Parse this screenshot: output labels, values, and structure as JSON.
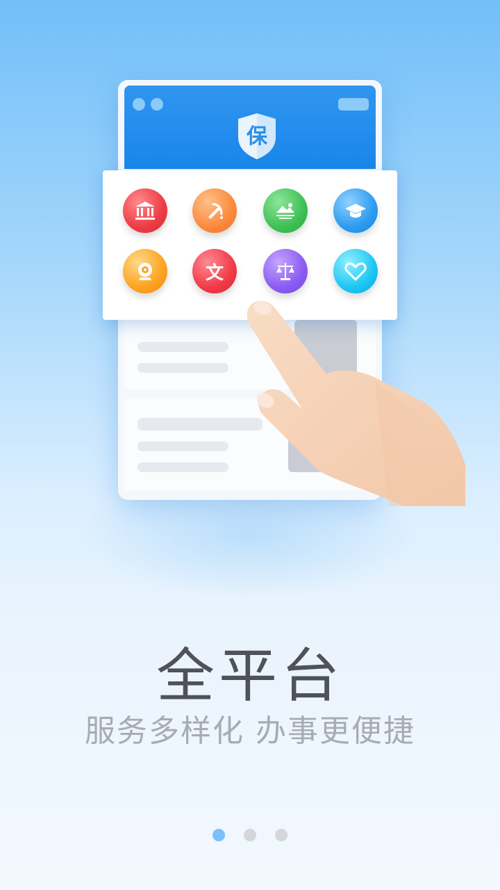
{
  "mockup": {
    "shield_label": "保",
    "icons": [
      {
        "name": "government-building-icon",
        "color": "#ee3b45"
      },
      {
        "name": "party-emblem-icon",
        "color": "#fb8a3c"
      },
      {
        "name": "landscape-icon",
        "color": "#3fc055"
      },
      {
        "name": "graduation-cap-icon",
        "color": "#2d9cf0"
      },
      {
        "name": "webcam-icon",
        "color": "#fca320"
      },
      {
        "name": "culture-icon",
        "color": "#f23a48",
        "label": "文"
      },
      {
        "name": "justice-scale-icon",
        "color": "#8a5cf2"
      },
      {
        "name": "heart-icon",
        "color": "#1ec6f4"
      }
    ]
  },
  "intro": {
    "title": "全平台",
    "subtitle": "服务多样化 办事更便捷"
  },
  "pager": {
    "count": 3,
    "active_index": 0,
    "active_color": "#7cc0f7",
    "inactive_color": "#d4d6da"
  }
}
